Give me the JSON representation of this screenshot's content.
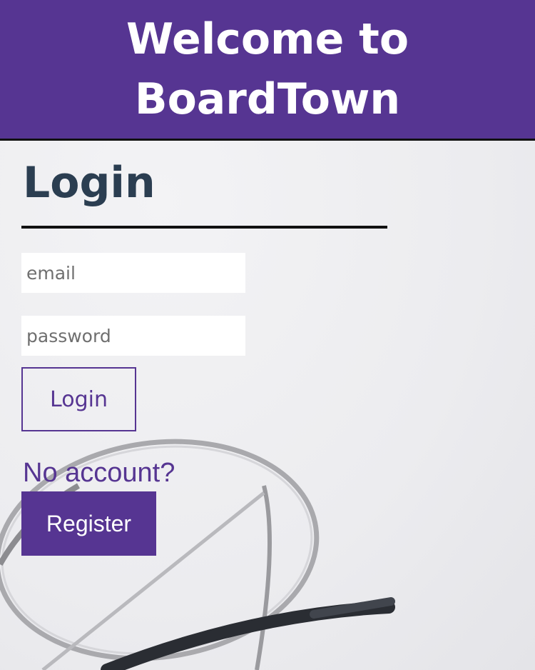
{
  "header": {
    "title": "Welcome to BoardTown"
  },
  "login": {
    "title": "Login",
    "email": {
      "placeholder": "email",
      "value": ""
    },
    "password": {
      "placeholder": "password",
      "value": ""
    },
    "submit_label": "Login"
  },
  "register": {
    "prompt": "No account?",
    "button_label": "Register"
  },
  "colors": {
    "brand_purple": "#563592",
    "title_navy": "#2b3e51",
    "divider": "#111111",
    "input_background": "#ffffff"
  },
  "background": {
    "icon": "eyeglasses-icon"
  }
}
